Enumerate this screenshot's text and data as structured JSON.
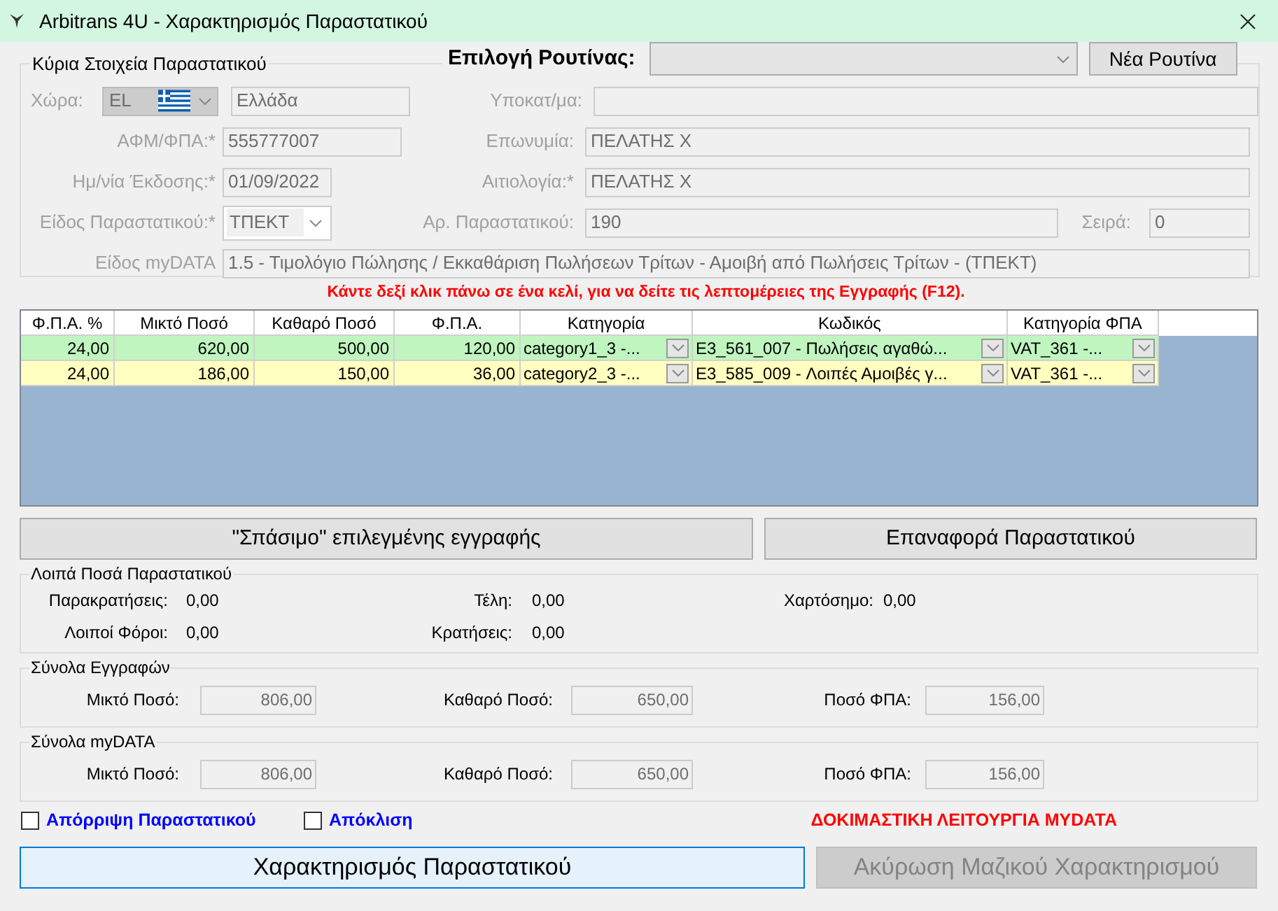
{
  "window": {
    "title": "Arbitrans 4U - Χαρακτηρισμός Παραστατικού"
  },
  "routine": {
    "label": "Επιλογή Ρουτίνας:",
    "button": "Νέα Ρουτίνα"
  },
  "main": {
    "title": "Κύρια Στοιχεία Παραστατικού",
    "disabled": true,
    "country": {
      "label": "Χώρα:",
      "code": "EL",
      "name": "Ελλάδα"
    },
    "rows": [
      {
        "left": {
          "label": "ΑΦΜ/ΦΠΑ:*",
          "value": "555777007",
          "kind": "text"
        },
        "right": {
          "label": "Επωνυμία:",
          "value": "ΠΕΛΑΤΗΣ Χ"
        }
      },
      {
        "left": {
          "label": "Ημ/νία Έκδοσης:*",
          "value": "01/09/2022",
          "kind": "text"
        },
        "right": {
          "label": "Αιτιολογία:*",
          "value": "ΠΕΛΑΤΗΣ Χ"
        }
      },
      {
        "left": {
          "label": "Είδος Παραστατικού:*",
          "value": "ΤΠΕΚΤ",
          "kind": "combo"
        },
        "right": {
          "label": "Αρ. Παραστατικού:",
          "value": "190"
        }
      }
    ],
    "subcategory": {
      "label": "Υποκατ/μα:"
    },
    "series": {
      "label": "Σειρά:",
      "value": "0"
    },
    "mydata_type": {
      "label": "Είδος myDATA",
      "value": "1.5 - Τιμολόγιο Πώλησης / Εκκαθάριση Πωλήσεων Τρίτων - Αμοιβή από Πωλήσεις Τρίτων - (ΤΠΕΚΤ)"
    }
  },
  "hint": "Κάντε δεξί κλικ πάνω σε ένα κελί, για να δείτε τις λεπτομέρειες της Εγγραφής (F12).",
  "grid": {
    "columns": [
      {
        "label": "Φ.Π.Α. %",
        "kind": "number"
      },
      {
        "label": "Μικτό Ποσό",
        "kind": "number"
      },
      {
        "label": "Καθαρό Ποσό",
        "kind": "number"
      },
      {
        "label": "Φ.Π.Α.",
        "kind": "number"
      },
      {
        "label": "Κατηγορία",
        "kind": "combo"
      },
      {
        "label": "Κωδικός",
        "kind": "combo"
      },
      {
        "label": "Κατηγορία ΦΠΑ",
        "kind": "combo"
      }
    ],
    "rows": [
      {
        "color": "#c0f5c0",
        "cells": [
          "24,00",
          "620,00",
          "500,00",
          "120,00",
          "category1_3  -...",
          "E3_561_007  -  Πωλήσεις αγαθώ...",
          "VAT_361  -..."
        ]
      },
      {
        "color": "#ffffc0",
        "cells": [
          "24,00",
          "186,00",
          "150,00",
          "36,00",
          "category2_3  -...",
          "E3_585_009  -  Λοιπές Αμοιβές γ...",
          "VAT_361  -..."
        ]
      }
    ]
  },
  "buttons": [
    "\"Σπάσιμο\" επιλεγμένης εγγραφής",
    "Επαναφορά Παραστατικού"
  ],
  "other_amounts": {
    "title": "Λοιπά Ποσά Παραστατικού",
    "rows": [
      [
        {
          "label": "Παρακρατήσεις:",
          "value": "0,00"
        },
        {
          "label": "Τέλη:",
          "value": "0,00"
        },
        {
          "label": "Χαρτόσημο:",
          "value": "0,00"
        }
      ],
      [
        {
          "label": "Λοιποί Φόροι:",
          "value": "0,00"
        },
        {
          "label": "Κρατήσεις:",
          "value": "0,00"
        }
      ]
    ]
  },
  "totals": [
    {
      "title": "Σύνολα Εγγραφών",
      "fields": [
        {
          "label": "Μικτό Ποσό:",
          "value": "806,00"
        },
        {
          "label": "Καθαρό Ποσό:",
          "value": "650,00"
        },
        {
          "label": "Ποσό ΦΠΑ:",
          "value": "156,00"
        }
      ]
    },
    {
      "title": "Σύνολα myDATA",
      "fields": [
        {
          "label": "Μικτό Ποσό:",
          "value": "806,00"
        },
        {
          "label": "Καθαρό Ποσό:",
          "value": "650,00"
        },
        {
          "label": "Ποσό ΦΠΑ:",
          "value": "156,00"
        }
      ]
    }
  ],
  "options": [
    {
      "label": "Απόρριψη Παραστατικού",
      "checked": false
    },
    {
      "label": "Απόκλιση",
      "checked": false
    }
  ],
  "test_mode": "ΔΟΚΙΜΑΣΤΙΚΗ ΛΕΙΤΟΥΡΓΙΑ MYDATA",
  "actions": [
    {
      "label": "Χαρακτηρισμός Παραστατικού",
      "disabled": false
    },
    {
      "label": "Ακύρωση Μαζικού Χαρακτηρισμού",
      "disabled": true
    }
  ]
}
